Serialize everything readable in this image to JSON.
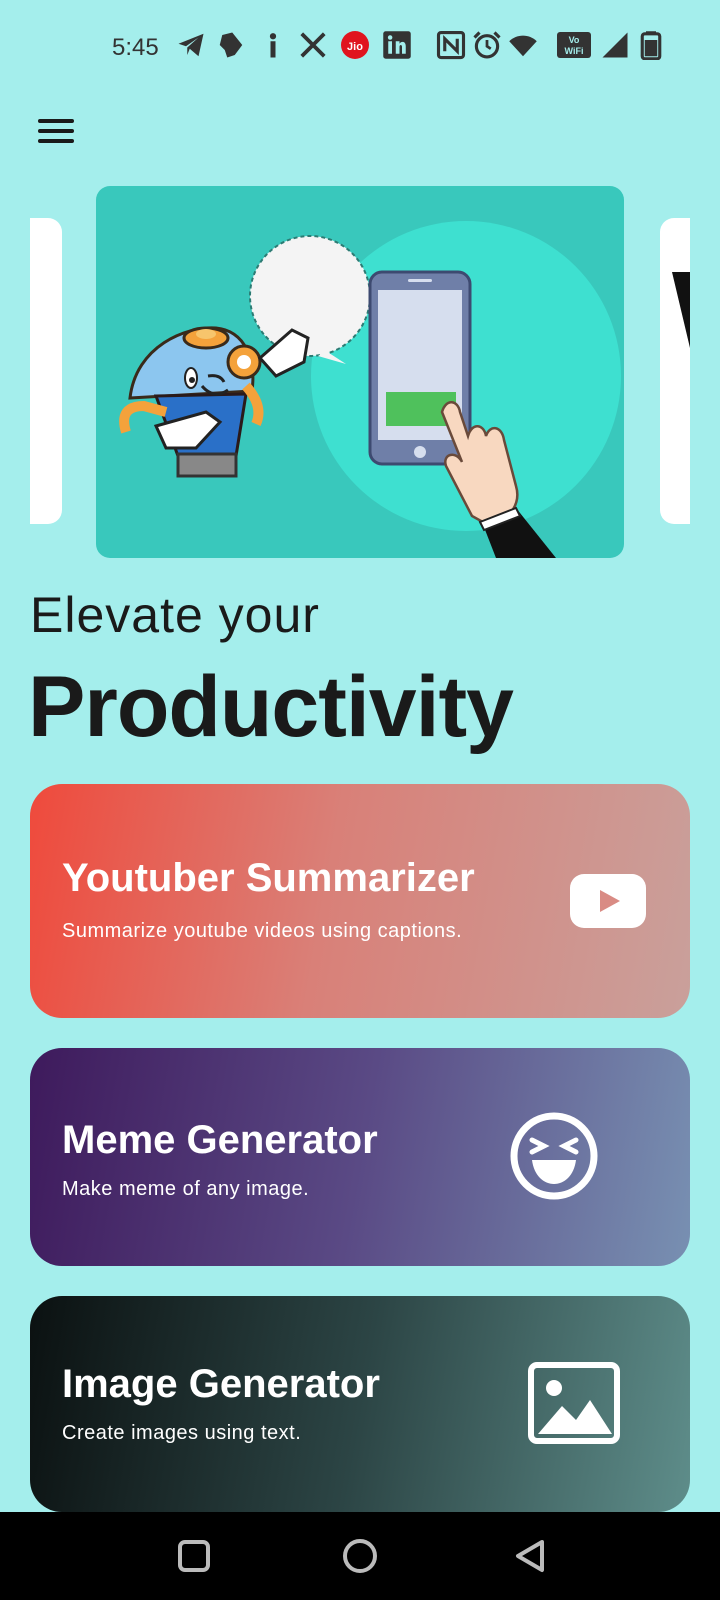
{
  "status_bar": {
    "time": "5:45",
    "icons": [
      "telegram-icon",
      "notification-bubble-icon",
      "info-icon",
      "x-icon",
      "jio-icon",
      "linkedin-icon",
      "nfc-icon",
      "alarm-icon",
      "wifi-icon",
      "vowifi-icon",
      "signal-icon",
      "battery-icon"
    ],
    "jio_label": "Jio",
    "vowifi_label": "Vo WiFi"
  },
  "menu": {
    "icon": "hamburger-menu-icon"
  },
  "hero": {
    "line1": "Elevate your",
    "line2": "Productivity"
  },
  "cards": [
    {
      "title": "Youtuber Summarizer",
      "subtitle": "Summarize youtube videos using captions.",
      "icon": "youtube-play-icon"
    },
    {
      "title": "Meme Generator",
      "subtitle": "Make meme of any image.",
      "icon": "laughing-face-icon"
    },
    {
      "title": "Image Generator",
      "subtitle": "Create images using text.",
      "icon": "image-icon"
    }
  ],
  "colors": {
    "background": "#a4eeec",
    "slide_bg": "#39c8bc",
    "card1_start": "#ef4a3c",
    "card2_start": "#3e1a5c",
    "card3_start": "#0b1111"
  },
  "nav": [
    "recent-apps-icon",
    "home-icon",
    "back-icon"
  ]
}
